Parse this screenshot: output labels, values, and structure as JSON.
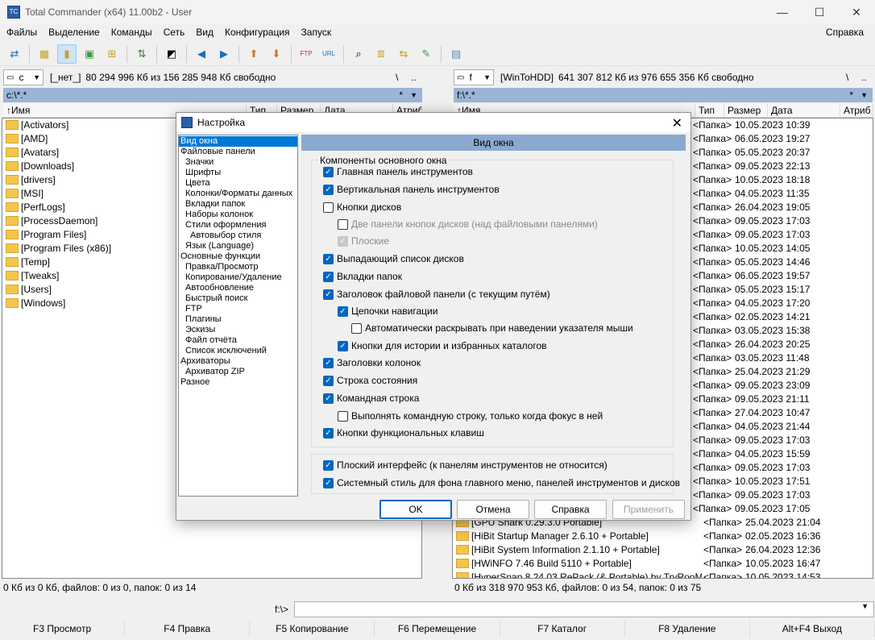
{
  "window": {
    "title": "Total Commander (x64) 11.00b2 - User",
    "minimize": "—",
    "maximize": "☐",
    "close": "✕"
  },
  "menu": [
    "Файлы",
    "Выделение",
    "Команды",
    "Сеть",
    "Вид",
    "Конфигурация",
    "Запуск"
  ],
  "menu_help": "Справка",
  "left": {
    "drive": "c",
    "drive_label": "[_нет_]",
    "free": "80 294 996 Кб из 156 285 948 Кб свободно",
    "path": "c:\\*.*",
    "cols": [
      "↑Имя",
      "Тип",
      "Размер",
      "Дата",
      "Атриб"
    ],
    "files": [
      "[Activators]",
      "[AMD]",
      "[Avatars]",
      "[Downloads]",
      "[drivers]",
      "[MSI]",
      "[PerfLogs]",
      "[ProcessDaemon]",
      "[Program Files]",
      "[Program Files (x86)]",
      "[Temp]",
      "[Tweaks]",
      "[Users]",
      "[Windows]"
    ],
    "status": "0 Кб из 0 Кб, файлов: 0 из 0, папок: 0 из 14"
  },
  "right": {
    "drive": "f",
    "drive_label": "[WinToHDD]",
    "free": "641 307 812 Кб из 976 655 356 Кб свободно",
    "path": "f:\\*.*",
    "cols": [
      "↑Имя",
      "Тип",
      "Размер",
      "Дата",
      "Атриб"
    ],
    "rows": [
      {
        "t": "",
        "s": "<Папка>",
        "d": "10.05.2023 10:39"
      },
      {
        "t": "e) by..]",
        "s": "<Папка>",
        "d": "06.05.2023 19:27"
      },
      {
        "t": "e) by..]",
        "s": "<Папка>",
        "d": "05.05.2023 20:37"
      },
      {
        "t": "uK]",
        "s": "<Папка>",
        "d": "09.05.2023 22:13"
      },
      {
        "t": "[ Port..]",
        "s": "<Папка>",
        "d": "10.05.2023 18:18"
      },
      {
        "t": "",
        "s": "<Папка>",
        "d": "04.05.2023 11:35"
      },
      {
        "t": "by elc..]",
        "s": "<Папка>",
        "d": "26.04.2023 19:05"
      },
      {
        "t": "rtable..]",
        "s": "<Папка>",
        "d": "09.05.2023 17:03"
      },
      {
        "t": "& Port..]",
        "s": "<Папка>",
        "d": "09.05.2023 17:03"
      },
      {
        "t": "",
        "s": "<Папка>",
        "d": "10.05.2023 14:05"
      },
      {
        "t": "ble) by..]",
        "s": "<Папка>",
        "d": "05.05.2023 14:46"
      },
      {
        "t": "ortabl..]",
        "s": "<Папка>",
        "d": "06.05.2023 19:57"
      },
      {
        "t": "TryRo..]",
        "s": "<Папка>",
        "d": "05.05.2023 15:17"
      },
      {
        "t": "Editio..]",
        "s": "<Папка>",
        "d": "04.05.2023 17:20"
      },
      {
        "t": "chnici..]",
        "s": "<Папка>",
        "d": "02.05.2023 14:21"
      },
      {
        "t": "nhanc..]",
        "s": "<Папка>",
        "d": "03.05.2023 15:38"
      },
      {
        "t": "ack b..]",
        "s": "<Папка>",
        "d": "26.04.2023 20:25"
      },
      {
        "t": "",
        "s": "<Папка>",
        "d": "03.05.2023 11:48"
      },
      {
        "t": "",
        "s": "<Папка>",
        "d": "25.04.2023 21:29"
      },
      {
        "t": "a]",
        "s": "<Папка>",
        "d": "09.05.2023 23:09"
      },
      {
        "t": "",
        "s": "<Папка>",
        "d": "09.05.2023 21:11"
      },
      {
        "t": "",
        "s": "<Папка>",
        "d": "27.04.2023 10:47"
      },
      {
        "t": "3.36) R..]",
        "s": "<Папка>",
        "d": "04.05.2023 21:44"
      },
      {
        "t": "",
        "s": "<Папка>",
        "d": "09.05.2023 17:03"
      },
      {
        "t": "",
        "s": "<Папка>",
        "d": "04.05.2023 15:59"
      },
      {
        "t": "",
        "s": "<Папка>",
        "d": "09.05.2023 17:03"
      },
      {
        "t": "y elch..]",
        "s": "<Папка>",
        "d": "10.05.2023 17:51"
      },
      {
        "t": "by TryR..]",
        "s": "<Папка>",
        "d": "09.05.2023 17:03"
      },
      {
        "t": "by FC..]",
        "s": "<Папка>",
        "d": "09.05.2023 17:05"
      },
      {
        "t": "[GPU Shark 0.29.3.0 Portable]",
        "s": "<Папка>",
        "d": "25.04.2023 21:04"
      },
      {
        "t": "[HiBit Startup Manager 2.6.10 + Portable]",
        "s": "<Папка>",
        "d": "02.05.2023 16:36"
      },
      {
        "t": "[HiBit System Information 2.1.10 + Portable]",
        "s": "<Папка>",
        "d": "26.04.2023 12:36"
      },
      {
        "t": "[HWiNFO 7.46 Build 5110 + Portable]",
        "s": "<Папка>",
        "d": "10.05.2023 16:47"
      },
      {
        "t": "[HyperSnap 8.24.03 RePack (& Portable) by TryRooM]",
        "s": "<Папка>",
        "d": "10.05.2023 14:53"
      }
    ],
    "status": "0 Кб из 318 970 953 Кб, файлов: 0 из 54, папок: 0 из 75"
  },
  "cmd_label": "f:\\>",
  "fkeys": [
    "F3 Просмотр",
    "F4 Правка",
    "F5 Копирование",
    "F6 Перемещение",
    "F7 Каталог",
    "F8 Удаление",
    "Alt+F4 Выход"
  ],
  "dialog": {
    "title": "Настройка",
    "tree": [
      {
        "label": "Вид окна",
        "lvl": 1,
        "sel": true
      },
      {
        "label": "Файловые панели",
        "lvl": 1
      },
      {
        "label": "Значки",
        "lvl": 2
      },
      {
        "label": "Шрифты",
        "lvl": 2
      },
      {
        "label": "Цвета",
        "lvl": 2
      },
      {
        "label": "Колонки/Форматы данных",
        "lvl": 2
      },
      {
        "label": "Вкладки папок",
        "lvl": 2
      },
      {
        "label": "Наборы колонок",
        "lvl": 2
      },
      {
        "label": "Стили оформления",
        "lvl": 2
      },
      {
        "label": "Автовыбор стиля",
        "lvl": 3
      },
      {
        "label": "Язык (Language)",
        "lvl": 2
      },
      {
        "label": "Основные функции",
        "lvl": 1
      },
      {
        "label": "Правка/Просмотр",
        "lvl": 2
      },
      {
        "label": "Копирование/Удаление",
        "lvl": 2
      },
      {
        "label": "Автообновление",
        "lvl": 2
      },
      {
        "label": "Быстрый поиск",
        "lvl": 2
      },
      {
        "label": "FTP",
        "lvl": 2
      },
      {
        "label": "Плагины",
        "lvl": 2
      },
      {
        "label": "Эскизы",
        "lvl": 2
      },
      {
        "label": "Файл отчёта",
        "lvl": 2
      },
      {
        "label": "Список исключений",
        "lvl": 2
      },
      {
        "label": "Архиваторы",
        "lvl": 1
      },
      {
        "label": "Архиватор ZIP",
        "lvl": 2
      },
      {
        "label": "Разное",
        "lvl": 1
      }
    ],
    "header": "Вид окна",
    "group_title": "Компоненты основного окна",
    "checks": [
      {
        "label": "Главная панель инструментов",
        "on": true
      },
      {
        "label": "Вертикальная панель инструментов",
        "on": true
      },
      {
        "label": "Кнопки дисков",
        "on": false
      },
      {
        "label": "Две панели кнопок дисков (над файловыми панелями)",
        "on": false,
        "dis": true
      },
      {
        "label": "Плоские",
        "on": true,
        "dis": true
      },
      {
        "label": "Выпадающий список дисков",
        "on": true
      },
      {
        "label": "Вкладки папок",
        "on": true
      },
      {
        "label": "Заголовок файловой панели (с текущим путём)",
        "on": true
      },
      {
        "label": "Цепочки навигации",
        "on": true
      },
      {
        "label": "Автоматически раскрывать при наведении указателя мыши",
        "on": false
      },
      {
        "label": "Кнопки для истории и избранных каталогов",
        "on": true
      },
      {
        "label": "Заголовки колонок",
        "on": true
      },
      {
        "label": "Строка состояния",
        "on": true
      },
      {
        "label": "Командная строка",
        "on": true
      },
      {
        "label": "Выполнять командную строку, только когда фокус в ней",
        "on": false
      },
      {
        "label": "Кнопки функциональных клавиш",
        "on": true
      }
    ],
    "checks2": [
      {
        "label": "Плоский интерфейс (к панелям инструментов не относится)",
        "on": true
      },
      {
        "label": "Системный стиль для фона главного меню, панелей инструментов и дисков",
        "on": true
      }
    ],
    "buttons": {
      "ok": "OK",
      "cancel": "Отмена",
      "help": "Справка",
      "apply": "Применить"
    }
  }
}
